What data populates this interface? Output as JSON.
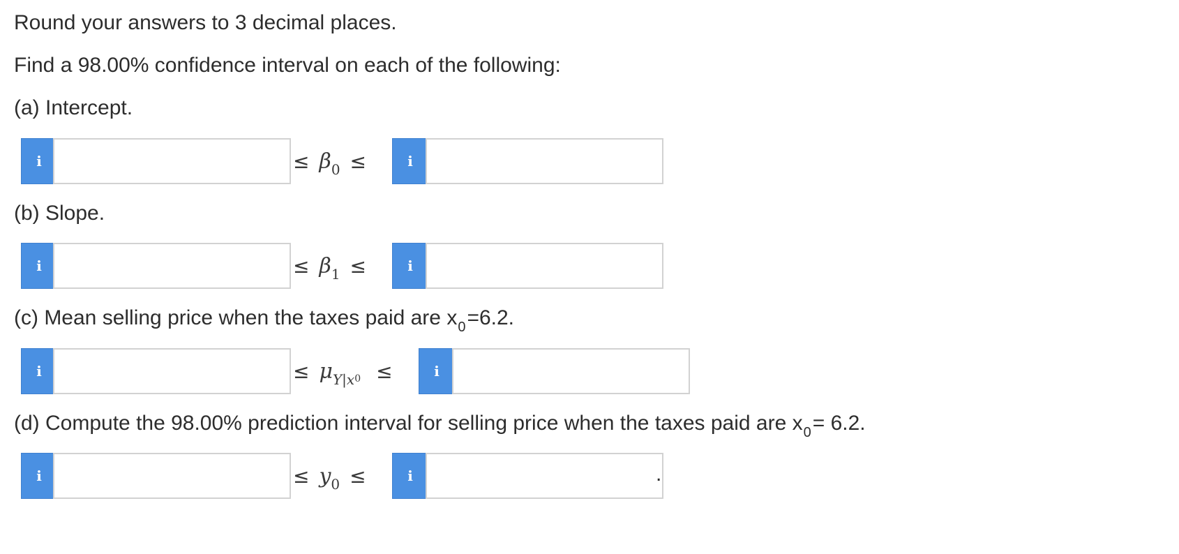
{
  "instructions": {
    "round_text": "Round your answers to 3 decimal places.",
    "find_text": "Find a 98.00% confidence interval on each of the following:"
  },
  "parts": {
    "a": {
      "label": "(a) Intercept.",
      "symbol": "β",
      "symbol_sub": "0",
      "lower_value": "",
      "upper_value": ""
    },
    "b": {
      "label": "(b) Slope.",
      "symbol": "β",
      "symbol_sub": "1",
      "lower_value": "",
      "upper_value": ""
    },
    "c": {
      "label_prefix": "(c) Mean selling price when the taxes paid are x",
      "label_sub": "0",
      "label_suffix": "=6.2.",
      "symbol": "μ",
      "symbol_sub": "Y|x",
      "symbol_subsub": "0",
      "lower_value": "",
      "upper_value": ""
    },
    "d": {
      "label_prefix": "(d) Compute the 98.00% prediction interval for selling price when the taxes paid are x",
      "label_sub": "0",
      "label_suffix": "= 6.2.",
      "symbol": "y",
      "symbol_sub": "0",
      "lower_value": "",
      "upper_value": "",
      "trailing": "."
    }
  },
  "relation": {
    "le_symbol": "≤"
  },
  "info_button": {
    "glyph": "i"
  },
  "icons": {
    "info": "info-icon"
  },
  "colors": {
    "info_button_bg": "#4a90e2",
    "input_border": "#d2d2d2",
    "text": "#2d2d2d"
  }
}
